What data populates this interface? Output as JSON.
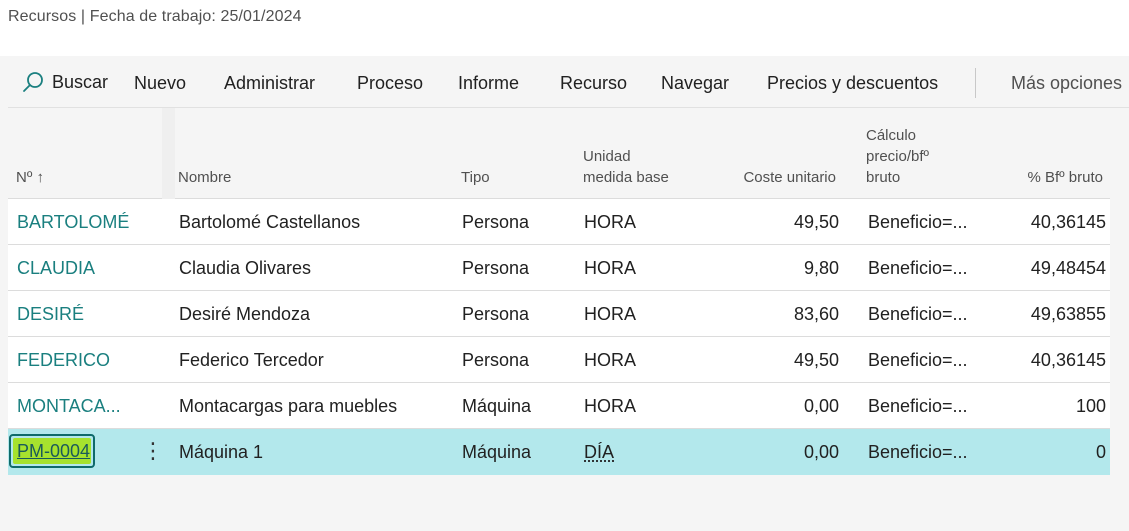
{
  "caption": "Recursos | Fecha de trabajo: 25/01/2024",
  "toolbar": {
    "search": "Buscar",
    "new": "Nuevo",
    "manage": "Administrar",
    "process": "Proceso",
    "report": "Informe",
    "resource": "Recurso",
    "navigate": "Navegar",
    "prices": "Precios y descuentos",
    "more": "Más opciones"
  },
  "columns": {
    "no": "Nº",
    "sort_arrow": "↑",
    "name": "Nombre",
    "type": "Tipo",
    "unit_line1": "Unidad",
    "unit_line2": "medida base",
    "unit_cost": "Coste unitario",
    "calc_line1": "Cálculo",
    "calc_line2": "precio/bfº",
    "calc_line3": "bruto",
    "profit_pct": "% Bfº bruto"
  },
  "rows": [
    {
      "no": "BARTOLOMÉ",
      "name": "Bartolomé Castellanos",
      "type": "Persona",
      "unit": "HORA",
      "cost": "49,50",
      "calc": "Beneficio=...",
      "pct": "40,36145"
    },
    {
      "no": "CLAUDIA",
      "name": "Claudia Olivares",
      "type": "Persona",
      "unit": "HORA",
      "cost": "9,80",
      "calc": "Beneficio=...",
      "pct": "49,48454"
    },
    {
      "no": "DESIRÉ",
      "name": "Desiré Mendoza",
      "type": "Persona",
      "unit": "HORA",
      "cost": "83,60",
      "calc": "Beneficio=...",
      "pct": "49,63855"
    },
    {
      "no": "FEDERICO",
      "name": "Federico Tercedor",
      "type": "Persona",
      "unit": "HORA",
      "cost": "49,50",
      "calc": "Beneficio=...",
      "pct": "40,36145"
    },
    {
      "no": "MONTACA...",
      "name": "Montacargas para muebles",
      "type": "Máquina",
      "unit": "HORA",
      "cost": "0,00",
      "calc": "Beneficio=...",
      "pct": "100"
    },
    {
      "no": "PM-0004",
      "name": "Máquina 1",
      "type": "Máquina",
      "unit": "DÍA",
      "cost": "0,00",
      "calc": "Beneficio=...",
      "pct": "0"
    }
  ],
  "row_menu_glyph": "⋮",
  "colors": {
    "link": "#1a7f7f",
    "selected_row": "#b3e8ec",
    "highlight": "#a6e22e",
    "page_bg": "#f5f5f5"
  }
}
